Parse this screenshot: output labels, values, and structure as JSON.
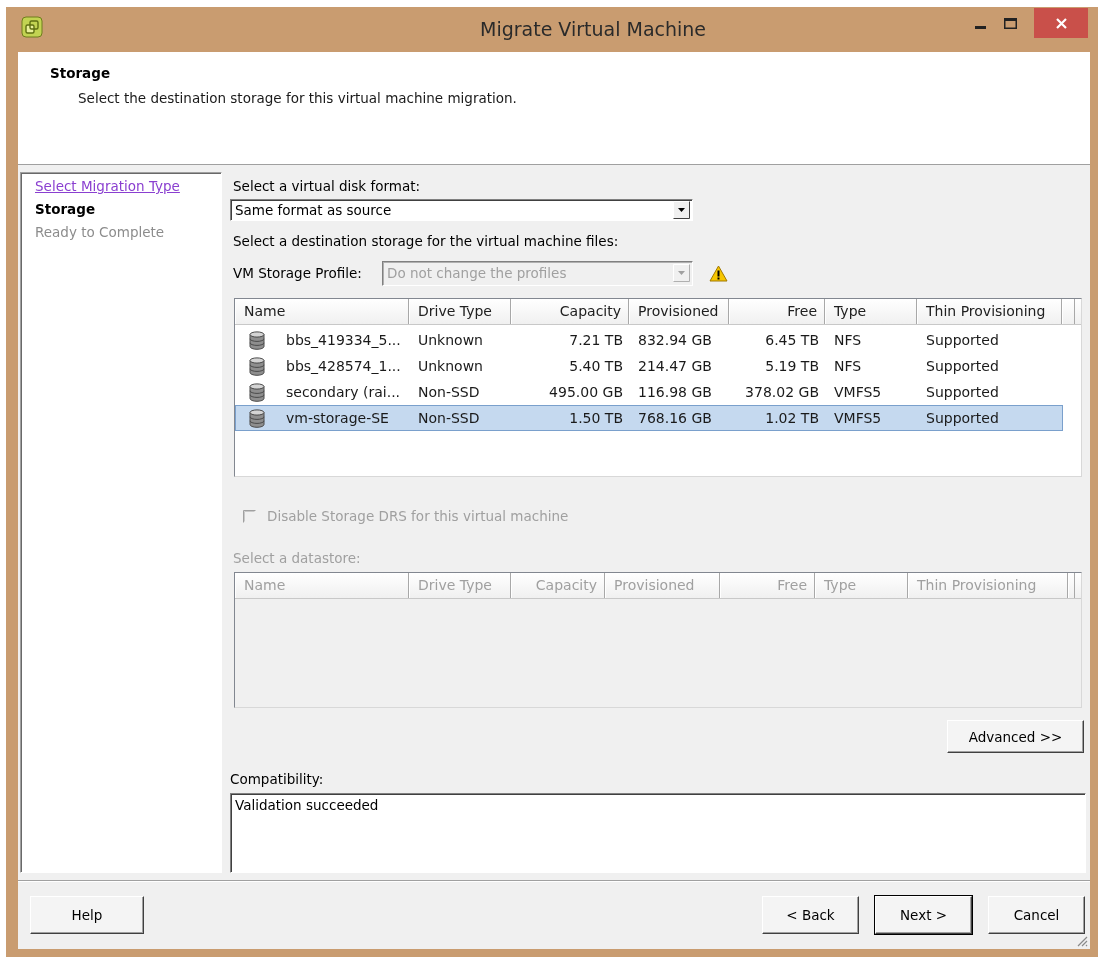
{
  "window": {
    "title": "Migrate Virtual Machine"
  },
  "header": {
    "title": "Storage",
    "subtitle": "Select the destination storage for this virtual machine migration."
  },
  "steps": [
    {
      "label": "Select Migration Type",
      "selected": false,
      "disabled": false
    },
    {
      "label": "Storage",
      "selected": true,
      "disabled": false
    },
    {
      "label": "Ready to Complete",
      "selected": false,
      "disabled": true
    }
  ],
  "disk_format": {
    "label": "Select a virtual disk format:",
    "value": "Same format as source"
  },
  "destination": {
    "label": "Select a destination storage for the virtual machine files:"
  },
  "storage_profile": {
    "label": "VM Storage Profile:",
    "value": "Do not change the profiles",
    "disabled": true,
    "warning": true
  },
  "datastores": {
    "columns": [
      "Name",
      "Drive Type",
      "Capacity",
      "Provisioned",
      "Free",
      "Type",
      "Thin Provisioning"
    ],
    "rows": [
      {
        "cells": [
          "bbs_419334_5...",
          "Unknown",
          "7.21 TB",
          "832.94 GB",
          "6.45 TB",
          "NFS",
          "Supported"
        ],
        "selected": false
      },
      {
        "cells": [
          "bbs_428574_1...",
          "Unknown",
          "5.40 TB",
          "214.47 GB",
          "5.19 TB",
          "NFS",
          "Supported"
        ],
        "selected": false
      },
      {
        "cells": [
          "secondary (rai...",
          "Non-SSD",
          "495.00 GB",
          "116.98 GB",
          "378.02 GB",
          "VMFS5",
          "Supported"
        ],
        "selected": false
      },
      {
        "cells": [
          "vm-storage-SE",
          "Non-SSD",
          "1.50 TB",
          "768.16 GB",
          "1.02 TB",
          "VMFS5",
          "Supported"
        ],
        "selected": true
      }
    ]
  },
  "storage_drs": {
    "label": "Disable Storage DRS for this virtual machine",
    "checked": false,
    "disabled": true
  },
  "datastore_picker": {
    "label": "Select a datastore:",
    "disabled": true,
    "columns": [
      "Name",
      "Drive Type",
      "Capacity",
      "Provisioned",
      "Free",
      "Type",
      "Thin Provisioning"
    ]
  },
  "advanced_button": {
    "label": "Advanced >>"
  },
  "compatibility": {
    "label": "Compatibility:",
    "value": "Validation succeeded"
  },
  "footer": {
    "left_buttons": [
      {
        "label": "Help",
        "default": false
      }
    ],
    "right_buttons": [
      {
        "label": "< Back",
        "default": false
      },
      {
        "label": "Next >",
        "default": true
      },
      {
        "label": "Cancel",
        "default": false
      }
    ]
  }
}
